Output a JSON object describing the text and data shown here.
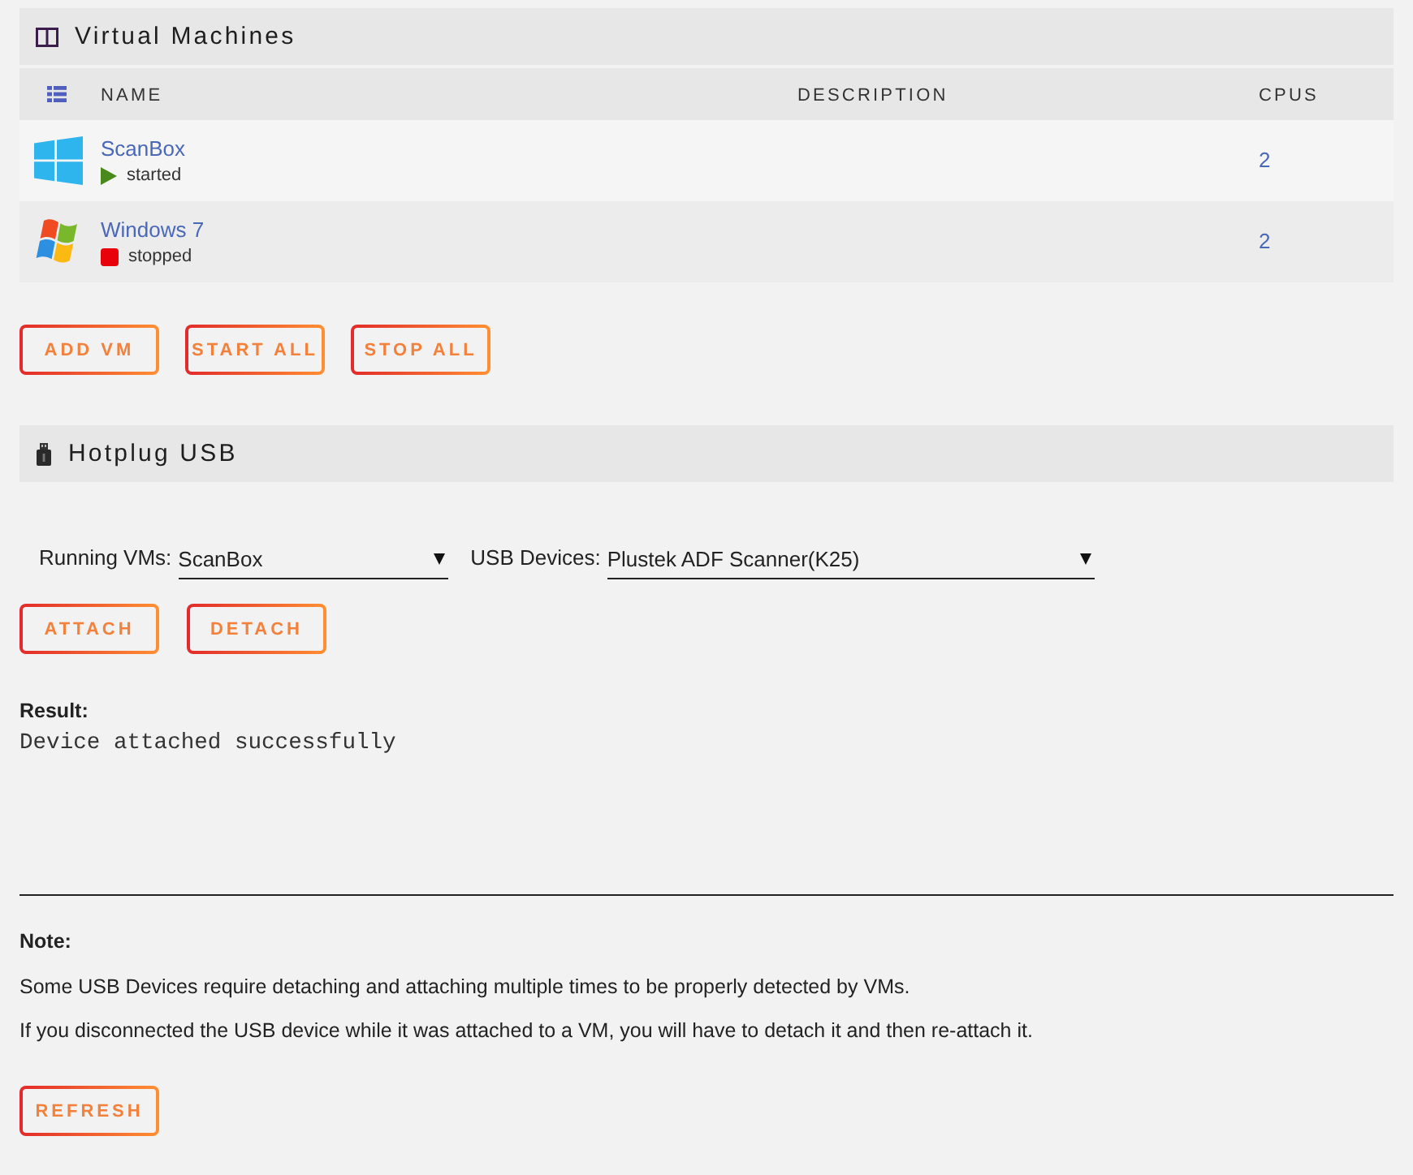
{
  "vm_panel": {
    "title": "Virtual Machines",
    "table": {
      "columns": [
        "NAME",
        "DESCRIPTION",
        "CPUS"
      ],
      "rows": [
        {
          "kind": "flat",
          "name": "ScanBox",
          "running": true,
          "status": "started",
          "cpus": "2"
        },
        {
          "kind": "flag",
          "name": "Windows 7",
          "running": false,
          "status": "stopped",
          "cpus": "2"
        }
      ]
    },
    "buttons": [
      "ADD VM",
      "START ALL",
      "STOP ALL"
    ]
  },
  "hotplug": {
    "title": "Hotplug USB",
    "selects": [
      {
        "label": "Running VMs:",
        "value": "ScanBox"
      },
      {
        "label": "USB Devices:",
        "value": "Plustek ADF Scanner(K25)"
      }
    ],
    "buttons": [
      "ATTACH",
      "DETACH"
    ],
    "result": {
      "label": "Result:",
      "text": "Device attached successfully"
    },
    "note": {
      "label": "Note:",
      "lines": [
        "Some USB Devices require detaching and attaching multiple times to be properly detected by VMs.",
        "If you disconnected the USB device while it was attached to a VM, you will have to detach it and then re-attach it."
      ]
    },
    "refresh_button": "REFRESH"
  }
}
